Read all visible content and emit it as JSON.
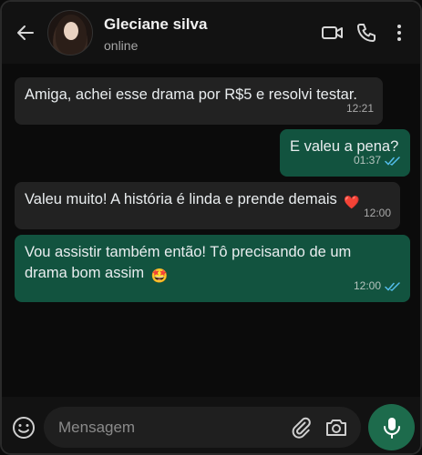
{
  "header": {
    "contact_name": "Gleciane silva",
    "status": "online",
    "icons": [
      "back-arrow-icon",
      "video-call-icon",
      "phone-icon",
      "more-vert-icon"
    ]
  },
  "messages": [
    {
      "direction": "incoming",
      "text": "Amiga, achei esse drama por R$5 e resolvi testar.",
      "time": "12:21"
    },
    {
      "direction": "outgoing",
      "text": "E valeu a pena?",
      "time": "01:37",
      "read": true
    },
    {
      "direction": "incoming",
      "text": "Valeu muito! A história é linda e prende demais",
      "emoji": "❤️",
      "time": "12:00"
    },
    {
      "direction": "outgoing",
      "text_line1": "Vou assistir também então! Tô precisando de um",
      "text_line2": "drama bom assim",
      "emoji": "🤩",
      "time": "12:00",
      "read": true
    }
  ],
  "composer": {
    "placeholder": "Mensagem"
  },
  "colors": {
    "header_bg": "#121212",
    "chat_bg": "#0b0b0b",
    "incoming_bubble": "#222222",
    "outgoing_bubble": "#12533f",
    "read_ticks": "#53bdeb",
    "mic_button": "#1d6b4c"
  }
}
